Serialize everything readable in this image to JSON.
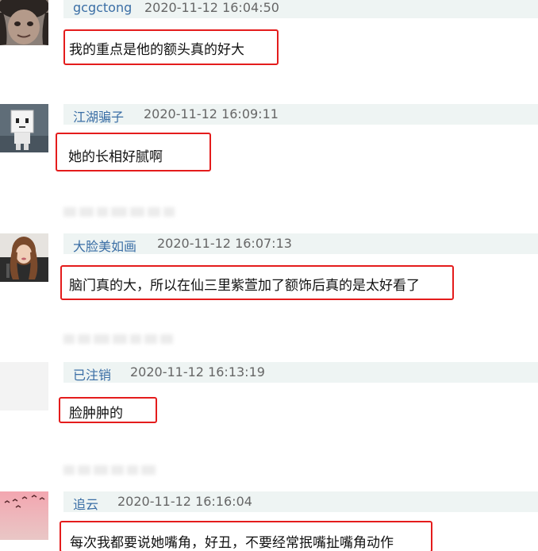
{
  "comments": [
    {
      "username": "gcgctong",
      "timestamp": "2020-11-12 16:04:50",
      "text": "我的重点是他的额头真的好大",
      "avatar_icon": "dark-hair-face-avatar"
    },
    {
      "username": "江湖骗子",
      "timestamp": "2020-11-12 16:09:11",
      "text": "她的长相好腻啊",
      "avatar_icon": "box-robot-avatar"
    },
    {
      "username": "大脸美如画",
      "timestamp": "2020-11-12 16:07:13",
      "text": "脑门真的大，所以在仙三里紫萱加了额饰后真的是太好看了",
      "avatar_icon": "woman-portrait-avatar"
    },
    {
      "username": "已注销",
      "timestamp": "2020-11-12 16:13:19",
      "text": "脸肿肿的",
      "avatar_icon": "blank-avatar"
    },
    {
      "username": "追云",
      "timestamp": "2020-11-12 16:16:04",
      "text": "每次我都要说她嘴角，好丑，不要经常抿嘴扯嘴角动作",
      "avatar_icon": "pink-sky-birds-avatar"
    }
  ],
  "colors": {
    "highlight_border": "#e41c1c",
    "username": "#3a6ea5",
    "header_background": "#eef4f3"
  }
}
